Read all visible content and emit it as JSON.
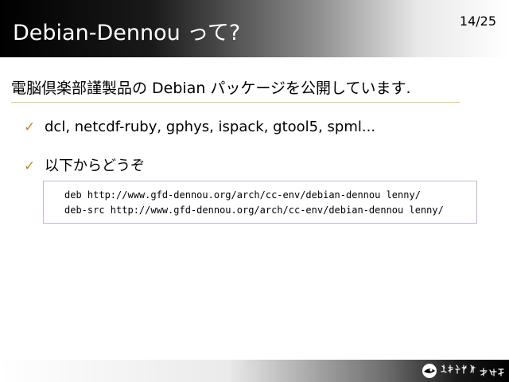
{
  "slide": {
    "title": "Debian-Dennou って?",
    "page_number": "14/25",
    "subtitle": "電脳倶楽部謹製品の Debian パッケージを公開しています.",
    "bullets": [
      {
        "text": "dcl, netcdf-ruby, gphys, ispack, gtool5, spml..."
      },
      {
        "text": "以下からどうぞ"
      }
    ],
    "check_glyph": "✓",
    "code_lines": [
      "deb http://www.gfd-dennou.org/arch/cc-env/debian-dennou lenny/",
      "deb-src http://www.gfd-dennou.org/arch/cc-env/debian-dennou lenny/"
    ]
  },
  "icons": {
    "bullet_icon": "check-icon",
    "footer_logo": "gfd-dennou-logo"
  },
  "colors": {
    "check_color": "#c8861a",
    "rule_color": "#e6c76a",
    "code_border": "#c9b4dc"
  }
}
